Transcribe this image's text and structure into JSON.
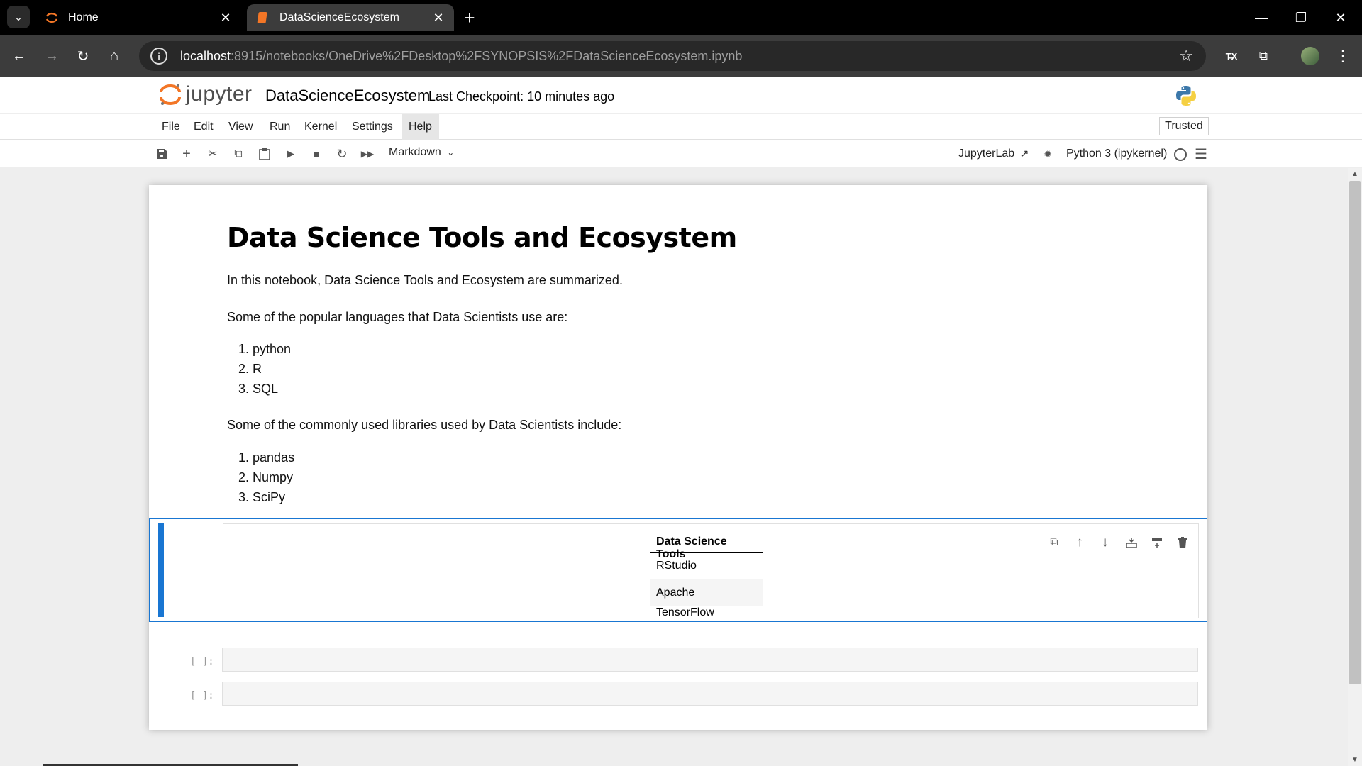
{
  "browser": {
    "tabs": [
      {
        "title": "Home",
        "close": "✕"
      },
      {
        "title": "DataScienceEcosystem",
        "close": "✕"
      }
    ],
    "address": {
      "host": "localhost",
      "path": ":8915/notebooks/OneDrive%2FDesktop%2FSYNOPSIS%2FDataScienceEcosystem.ipynb"
    }
  },
  "header": {
    "logo_text": "jupyter",
    "notebook_name": "DataScienceEcosystem",
    "checkpoint": "Last Checkpoint: 10 minutes ago"
  },
  "menu": {
    "items": [
      "File",
      "Edit",
      "View",
      "Run",
      "Kernel",
      "Settings",
      "Help"
    ],
    "trusted": "Trusted"
  },
  "toolbar": {
    "cell_type": "Markdown",
    "jupyterlab": "JupyterLab",
    "kernel": "Python 3 (ipykernel)"
  },
  "notebook": {
    "title": "Data Science Tools and Ecosystem",
    "intro": "In this notebook, Data Science Tools and Ecosystem are summarized.",
    "languages_intro": "Some of the popular languages that Data Scientists use are:",
    "languages": [
      "1. python",
      "2. R",
      "3. SQL"
    ],
    "libraries_intro": "Some of the commonly used libraries used by Data Scientists include:",
    "libraries": [
      "1. pandas",
      "2. Numpy",
      "3. SciPy"
    ],
    "table": {
      "header": "Data Science Tools",
      "rows": [
        "RStudio",
        "Apache",
        "TensorFlow"
      ]
    },
    "prompts": [
      "[ ]:",
      "[ ]:"
    ]
  },
  "colors": {
    "accent": "#1976d2",
    "jupyter_orange": "#f37626"
  }
}
